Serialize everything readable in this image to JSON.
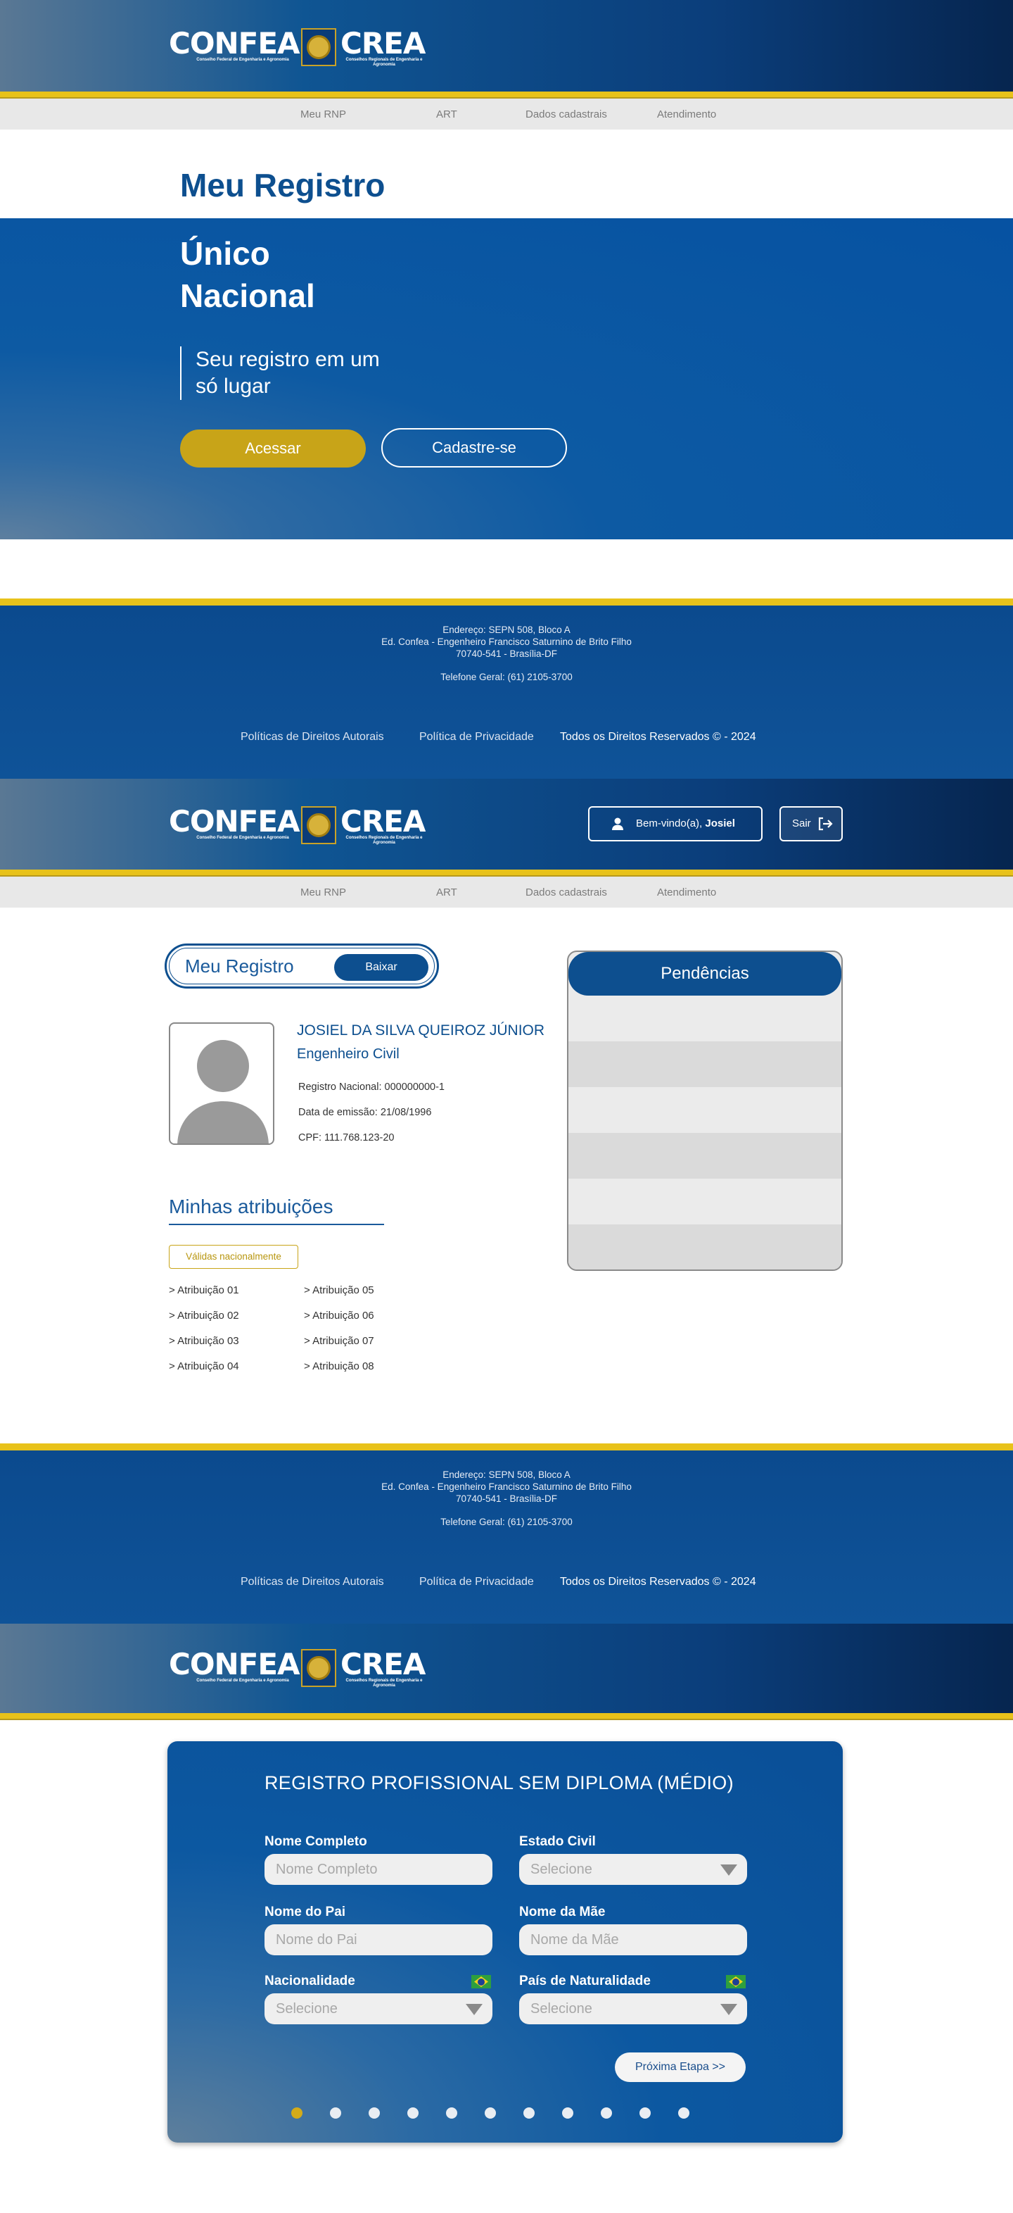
{
  "brand": {
    "left_word": "CONFEA",
    "left_sub": "Conselho Federal de Engenharia e Agronomia",
    "right_word": "CREA",
    "right_sub": "Conselhos Regionais de Engenharia e Agronomia"
  },
  "nav": {
    "items": [
      "Meu RNP",
      "ART",
      "Dados cadastrais",
      "Atendimento"
    ]
  },
  "landing": {
    "title": "Meu Registro",
    "hero_line1": "Único",
    "hero_line2": "Nacional",
    "slogan_line1": "Seu registro em um",
    "slogan_line2": "só lugar",
    "access_button": "Acessar",
    "signup_button": "Cadastre-se"
  },
  "footer": {
    "address_line1": "Endereço: SEPN 508, Bloco A",
    "address_line2": "Ed. Confea - Engenheiro Francisco Saturnino de Brito Filho",
    "address_line3": "70740-541 - Brasília-DF",
    "phone": "Telefone Geral: (61) 2105-3700",
    "link_copyright_policy": "Políticas de Direitos Autorais",
    "link_privacy": "Política de Privacidade",
    "copyright": "Todos os Direitos Reservados © - 2024"
  },
  "user_bar": {
    "welcome_prefix": "Bem-vindo(a),",
    "user_first_name": "Josiel",
    "logout_label": "Sair"
  },
  "profile": {
    "card_title": "Meu Registro",
    "download_button": "Baixar",
    "full_name": "JOSIEL DA SILVA QUEIROZ JÚNIOR",
    "profession": "Engenheiro Civil",
    "registration": "Registro Nacional:  000000000-1",
    "issue_date": "Data de emissão: 21/08/1996",
    "cpf": "CPF: 111.768.123-20"
  },
  "pendencias": {
    "title": "Pendências"
  },
  "attributions": {
    "title": "Minhas atribuições",
    "badge": "Válidas nacionalmente",
    "items": [
      "> Atribuição 01",
      "> Atribuição 02",
      "> Atribuição 03",
      "> Atribuição 04",
      "> Atribuição 05",
      "> Atribuição 06",
      "> Atribuição 07",
      "> Atribuição 08"
    ]
  },
  "form": {
    "title": "REGISTRO PROFISSIONAL SEM DIPLOMA (MÉDIO)",
    "full_name_label": "Nome Completo",
    "full_name_placeholder": "Nome Completo",
    "civil_status_label": "Estado Civil",
    "civil_status_value": "Selecione",
    "father_label": "Nome do Pai",
    "father_placeholder": "Nome do Pai",
    "mother_label": "Nome da Mãe",
    "mother_placeholder": "Nome da Mãe",
    "nationality_label": "Nacionalidade",
    "nationality_value": "Selecione",
    "birth_country_label": "País de Naturalidade",
    "birth_country_value": "Selecione",
    "next_button": "Próxima Etapa >>",
    "steps_total": 11,
    "current_step": 1
  },
  "colors": {
    "primary": "#0d4f8f",
    "accent_gold": "#c8a418",
    "stripe": "#e8c21a"
  }
}
